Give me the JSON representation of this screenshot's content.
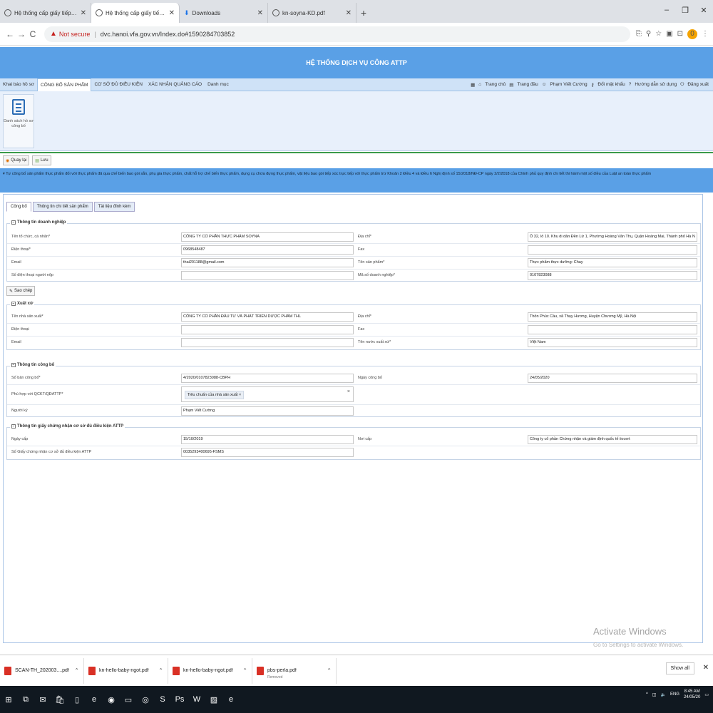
{
  "browser": {
    "tabs": [
      {
        "title": "Hệ thống cấp giấy tiếp nhận bả",
        "active": false,
        "icon": "globe-icon"
      },
      {
        "title": "Hệ thống cấp giấy tiếp nhận bả",
        "active": true,
        "icon": "globe-icon"
      },
      {
        "title": "Downloads",
        "active": false,
        "icon": "download-icon"
      },
      {
        "title": "kn-soyna-KD.pdf",
        "active": false,
        "icon": "globe-icon"
      }
    ],
    "security_label": "Not secure",
    "url": "dvc.hanoi.vfa.gov.vn/Index.do#1590284703852",
    "profile_initial": "0"
  },
  "app": {
    "title": "HỆ THỐNG DỊCH VỤ CÔNG ATTP",
    "menu": [
      "Khai báo hồ sơ",
      "CÔNG BỐ SẢN PHẨM",
      "CƠ SỞ ĐỦ ĐIỀU KIỆN",
      "XÁC NHẬN QUẢNG CÁO",
      "Danh mục"
    ],
    "active_menu": 1,
    "user_menu": [
      "Trang chủ",
      "Trang đầu",
      "Phạm Viết Cường",
      "Đổi mật khẩu",
      "Hướng dẫn sử dụng",
      "Đăng xuất"
    ],
    "ribbon_button": "Danh sách hồ sơ công bố",
    "toolbar": {
      "back": "Quay lại",
      "save": "Lưu"
    },
    "notice": "▾ Tự công bố sản phẩm thực phẩm đối với thực phẩm đã qua chế biến bao gói sẵn, phụ gia thực phẩm, chất hỗ trợ chế biến thực phẩm, dụng cụ chứa đựng thực phẩm, vật liệu bao gói tiếp xúc trực tiếp với thực phẩm trừ Khoản 2 Điều 4 và Điều 6 Nghị định số 15/2018/NĐ-CP ngày 2/2/2018 của Chính phủ quy định chi tiết thi hành một số điều của Luật an toàn thực phẩm",
    "subtabs": [
      "Công bố",
      "Thông tin chi tiết sản phẩm",
      "Tài liệu đính kèm"
    ]
  },
  "form": {
    "doanh_nghiep": {
      "legend": "Thông tin doanh nghiệp",
      "ten_label": "Tên tổ chức, cá nhân*",
      "ten": "CÔNG TY CỔ PHẦN THỰC PHẨM SOYNA",
      "diachi_label": "Địa chỉ*",
      "diachi": "Ô 32, lô 10. Khu di dân Đền Lừ 1, Phường Hoàng Văn Thụ, Quận Hoàng Mai, Thành phố Hà N",
      "dienthoai_label": "Điện thoại*",
      "dienthoai": "0968548487",
      "fax_label": "Fax",
      "fax": "",
      "email_label": "Email",
      "email": "thai201188@gmail.com",
      "sanpham_label": "Tên sản phẩm*",
      "sanpham": "Thực phẩm thực dưỡng: Chay",
      "sdt_nop_label": "Số điện thoại người nộp",
      "sdt_nop": "",
      "maso_label": "Mã số doanh nghiệp*",
      "maso": "0107823088"
    },
    "copy_button": "Sao chép",
    "xuat_xu": {
      "legend": "Xuất xứ",
      "ten_label": "Tên nhà sản xuất*",
      "ten": "CÔNG TY CỔ PHẦN ĐẦU TƯ VÀ PHÁT TRIỂN DƯỢC PHẨM THL",
      "diachi_label": "Địa chỉ*",
      "diachi": "Thôn Phúc Cầu, xã Thụy Hương, Huyện Chương Mỹ, Hà Nội",
      "dienthoai_label": "Điện thoại",
      "dienthoai": "",
      "fax_label": "Fax",
      "fax": "",
      "email_label": "Email",
      "email": "",
      "nuoc_label": "Tên nước xuất xứ*",
      "nuoc": "Việt Nam"
    },
    "cong_bo": {
      "legend": "Thông tin công bố",
      "so_label": "Số bản công bố*",
      "so": "4/2020/0107823088-CBPH",
      "ngay_label": "Ngày công bố",
      "ngay": "24/05/2020",
      "phuhop_label": "Phù hợp với QCKT/QĐATTP*",
      "phuhop_tag": "Tiêu chuẩn của nhà sản xuất",
      "nguoiky_label": "Người ký",
      "nguoiky": "Phạm Viết Cường"
    },
    "chung_nhan": {
      "legend": "Thông tin giấy chứng nhận cơ sở đủ điều kiện ATTP",
      "ngaycap_label": "Ngày cấp",
      "ngaycap": "15/10/2019",
      "noicap_label": "Nơi cấp",
      "noicap": "Công ty cổ phần Chứng nhận và giám định quốc tế iiocert",
      "so_label": "Số Giấy chứng nhận cơ sở đủ điều kiện ATTP",
      "so": "0035293400695-FSMS"
    }
  },
  "watermark": {
    "line1": "Activate Windows",
    "line2": "Go to Settings to activate Windows."
  },
  "downloads": [
    {
      "name": "SCAN-TH_202003....pdf",
      "sub": ""
    },
    {
      "name": "kn-hello-baby-ngot.pdf",
      "sub": ""
    },
    {
      "name": "kn-hello-baby-ngot.pdf",
      "sub": ""
    },
    {
      "name": "pbs-perla.pdf",
      "sub": "Removed"
    }
  ],
  "show_all": "Show all",
  "taskbar": {
    "lang": "ENG",
    "time": "8:45 AM",
    "date": "24/05/20"
  }
}
